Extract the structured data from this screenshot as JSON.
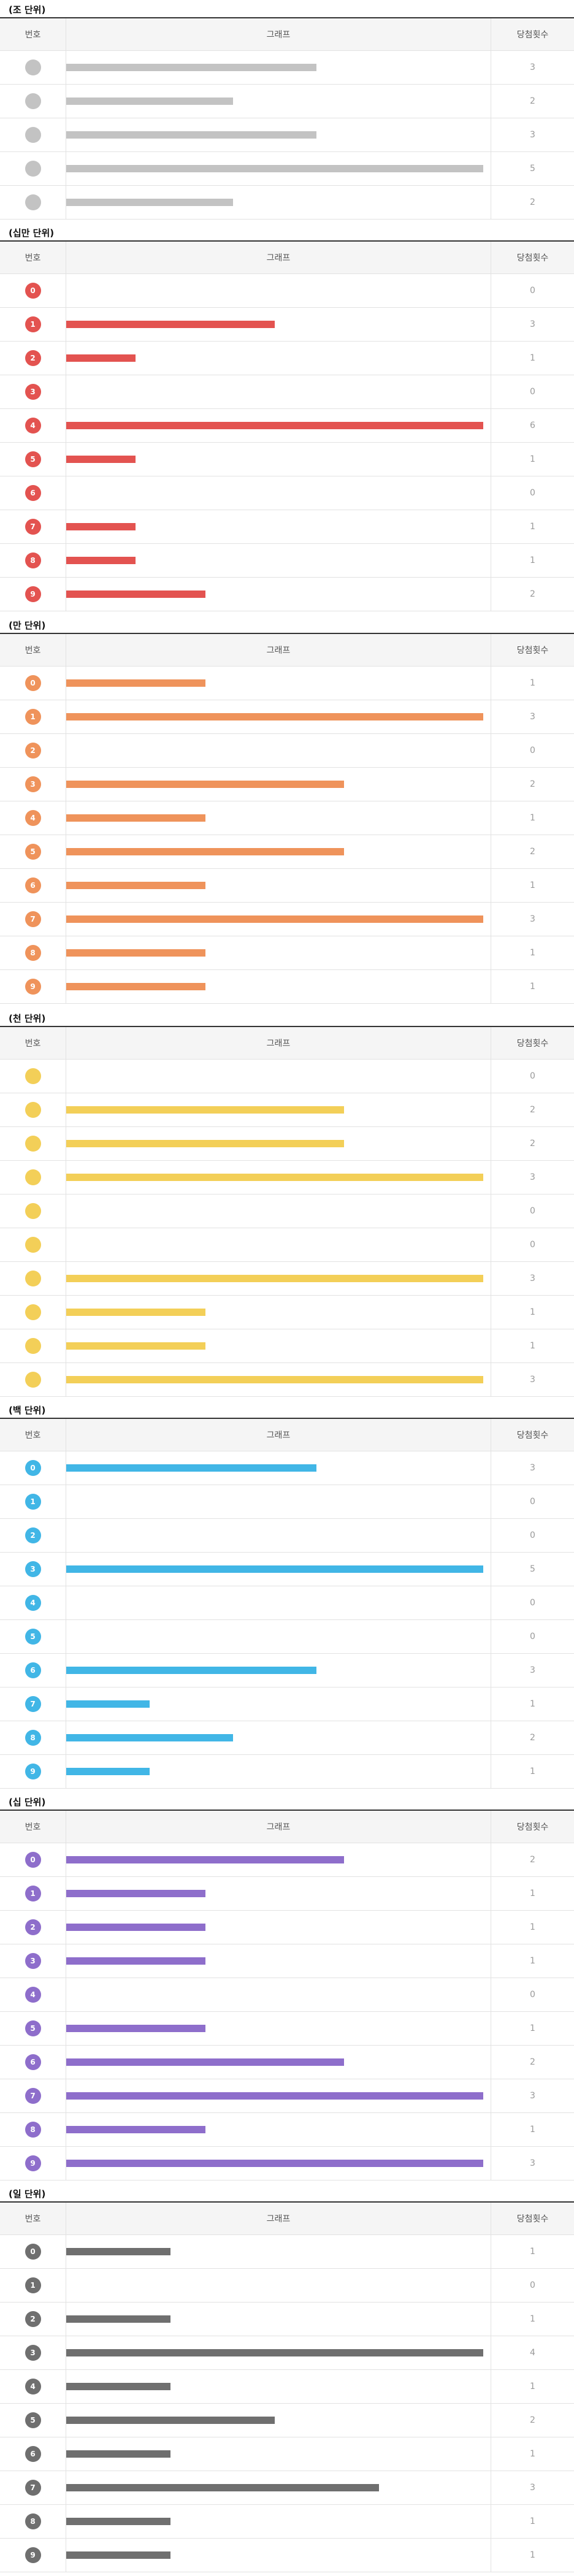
{
  "header": {
    "number": "번호",
    "graph": "그래프",
    "count": "당첨횟수"
  },
  "colors": {
    "section_0": "#c3c3c3",
    "section_1": "#e35350",
    "section_2": "#ef935b",
    "section_3": "#f3cf58",
    "section_4": "#41b6e6",
    "section_5": "#8e6ecb",
    "section_6": "#6f6f6f",
    "row_border": "#e2e2e2",
    "header_bg": "#f5f5f5"
  },
  "chart_data": [
    {
      "type": "bar",
      "title": "(조 단위)",
      "categories": [
        "",
        "",
        "",
        "",
        ""
      ],
      "values": [
        3,
        2,
        3,
        5,
        2
      ],
      "color": "#c3c3c3"
    },
    {
      "type": "bar",
      "title": "(십만 단위)",
      "categories": [
        "0",
        "1",
        "2",
        "3",
        "4",
        "5",
        "6",
        "7",
        "8",
        "9"
      ],
      "values": [
        0,
        3,
        1,
        0,
        6,
        1,
        0,
        1,
        1,
        2
      ],
      "color": "#e35350"
    },
    {
      "type": "bar",
      "title": "(만 단위)",
      "categories": [
        "0",
        "1",
        "2",
        "3",
        "4",
        "5",
        "6",
        "7",
        "8",
        "9"
      ],
      "values": [
        1,
        3,
        0,
        2,
        1,
        2,
        1,
        3,
        1,
        1
      ],
      "color": "#ef935b"
    },
    {
      "type": "bar",
      "title": "(천 단위)",
      "categories": [
        "",
        "",
        "",
        "",
        "",
        "",
        "",
        "",
        "",
        ""
      ],
      "values": [
        0,
        2,
        2,
        3,
        0,
        0,
        3,
        1,
        1,
        3
      ],
      "color": "#f3cf58"
    },
    {
      "type": "bar",
      "title": "(백 단위)",
      "categories": [
        "0",
        "1",
        "2",
        "3",
        "4",
        "5",
        "6",
        "7",
        "8",
        "9"
      ],
      "values": [
        3,
        0,
        0,
        5,
        0,
        0,
        3,
        1,
        2,
        1
      ],
      "color": "#41b6e6"
    },
    {
      "type": "bar",
      "title": "(십 단위)",
      "categories": [
        "0",
        "1",
        "2",
        "3",
        "4",
        "5",
        "6",
        "7",
        "8",
        "9"
      ],
      "values": [
        2,
        1,
        1,
        1,
        0,
        1,
        2,
        3,
        1,
        3
      ],
      "color": "#8e6ecb"
    },
    {
      "type": "bar",
      "title": "(일 단위)",
      "categories": [
        "0",
        "1",
        "2",
        "3",
        "4",
        "5",
        "6",
        "7",
        "8",
        "9"
      ],
      "values": [
        1,
        0,
        1,
        4,
        1,
        2,
        1,
        3,
        1,
        1
      ],
      "color": "#6f6f6f"
    }
  ]
}
